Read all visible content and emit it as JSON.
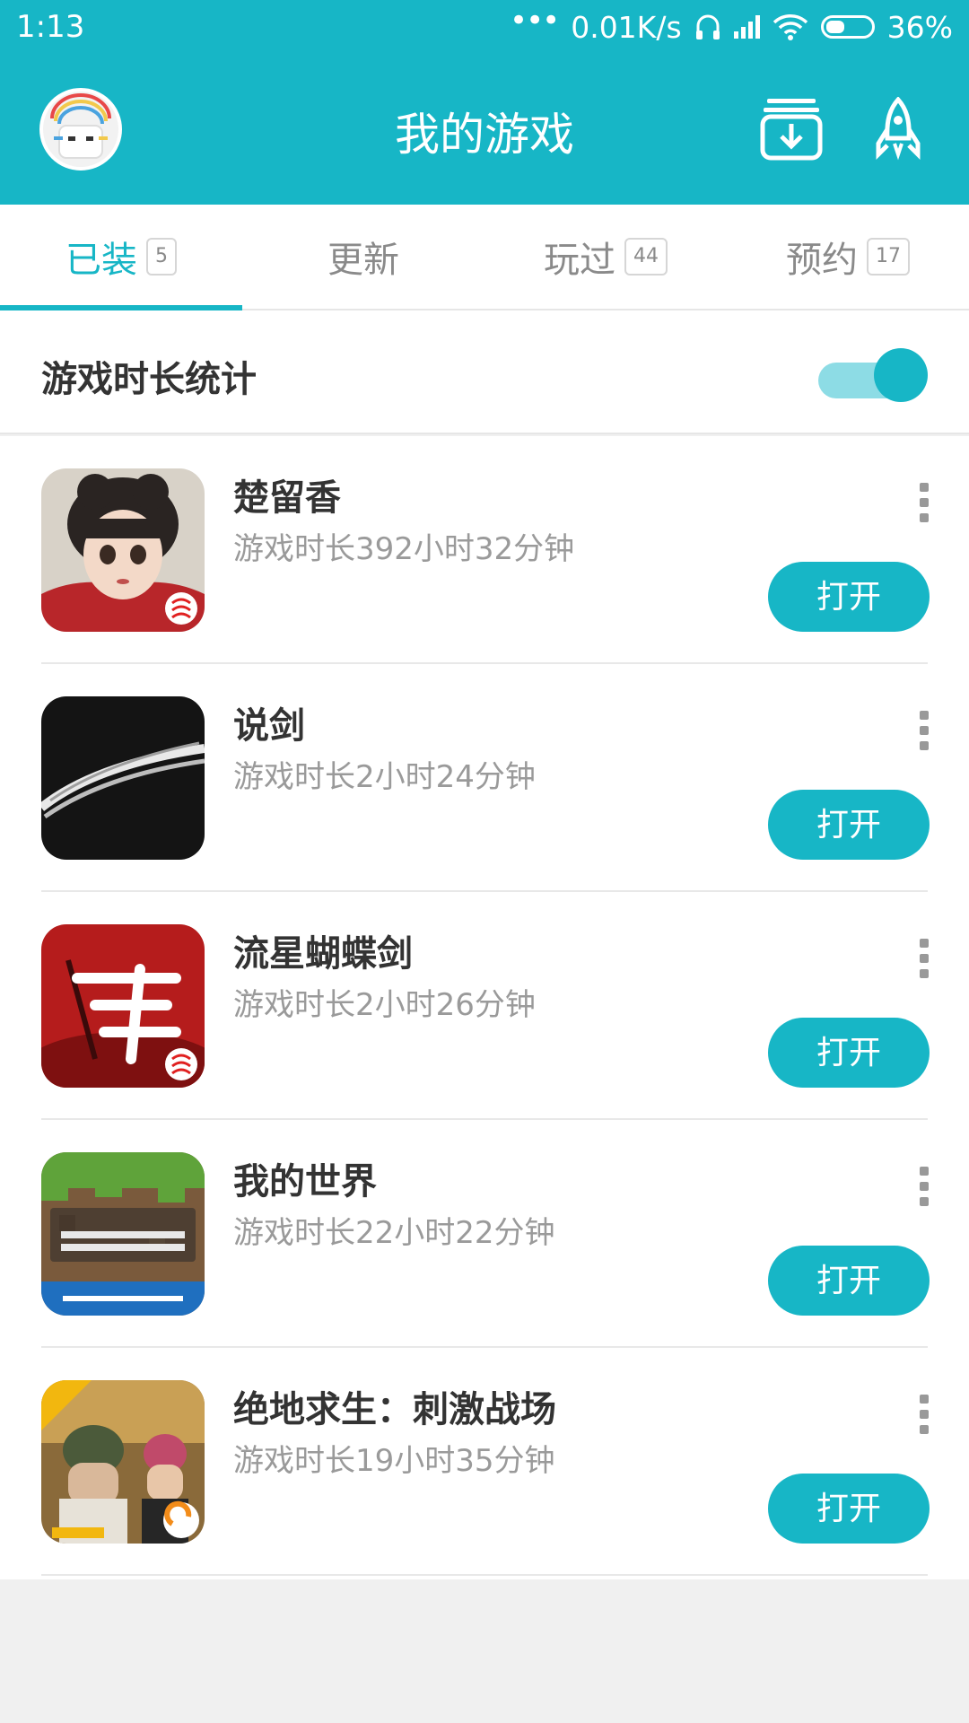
{
  "status_bar": {
    "time": "1:13",
    "dots": "•••",
    "network_speed": "0.01K/s",
    "battery": "36%"
  },
  "header": {
    "title": "我的游戏",
    "avatar_icon": "avatar",
    "download_icon": "download-manager-icon",
    "rocket_icon": "rocket-accelerate-icon"
  },
  "tabs": [
    {
      "label": "已装",
      "count": "5"
    },
    {
      "label": "更新",
      "count": ""
    },
    {
      "label": "玩过",
      "count": "44"
    },
    {
      "label": "预约",
      "count": "17"
    }
  ],
  "stats_toggle": {
    "label": "游戏时长统计",
    "on": true
  },
  "games": [
    {
      "name": "楚留香",
      "playtime": "游戏时长392小时32分钟",
      "button": "打开"
    },
    {
      "name": "说剑",
      "playtime": "游戏时长2小时24分钟",
      "button": "打开"
    },
    {
      "name": "流星蝴蝶剑",
      "playtime": "游戏时长2小时26分钟",
      "button": "打开"
    },
    {
      "name": "我的世界",
      "playtime": "游戏时长22小时22分钟",
      "button": "打开"
    },
    {
      "name": "绝地求生：刺激战场",
      "playtime": "游戏时长19小时35分钟",
      "button": "打开"
    }
  ],
  "colors": {
    "accent": "#17b6c6",
    "accent_light": "#8ddce5",
    "text": "#333333",
    "subtext": "#9a9a9a"
  }
}
